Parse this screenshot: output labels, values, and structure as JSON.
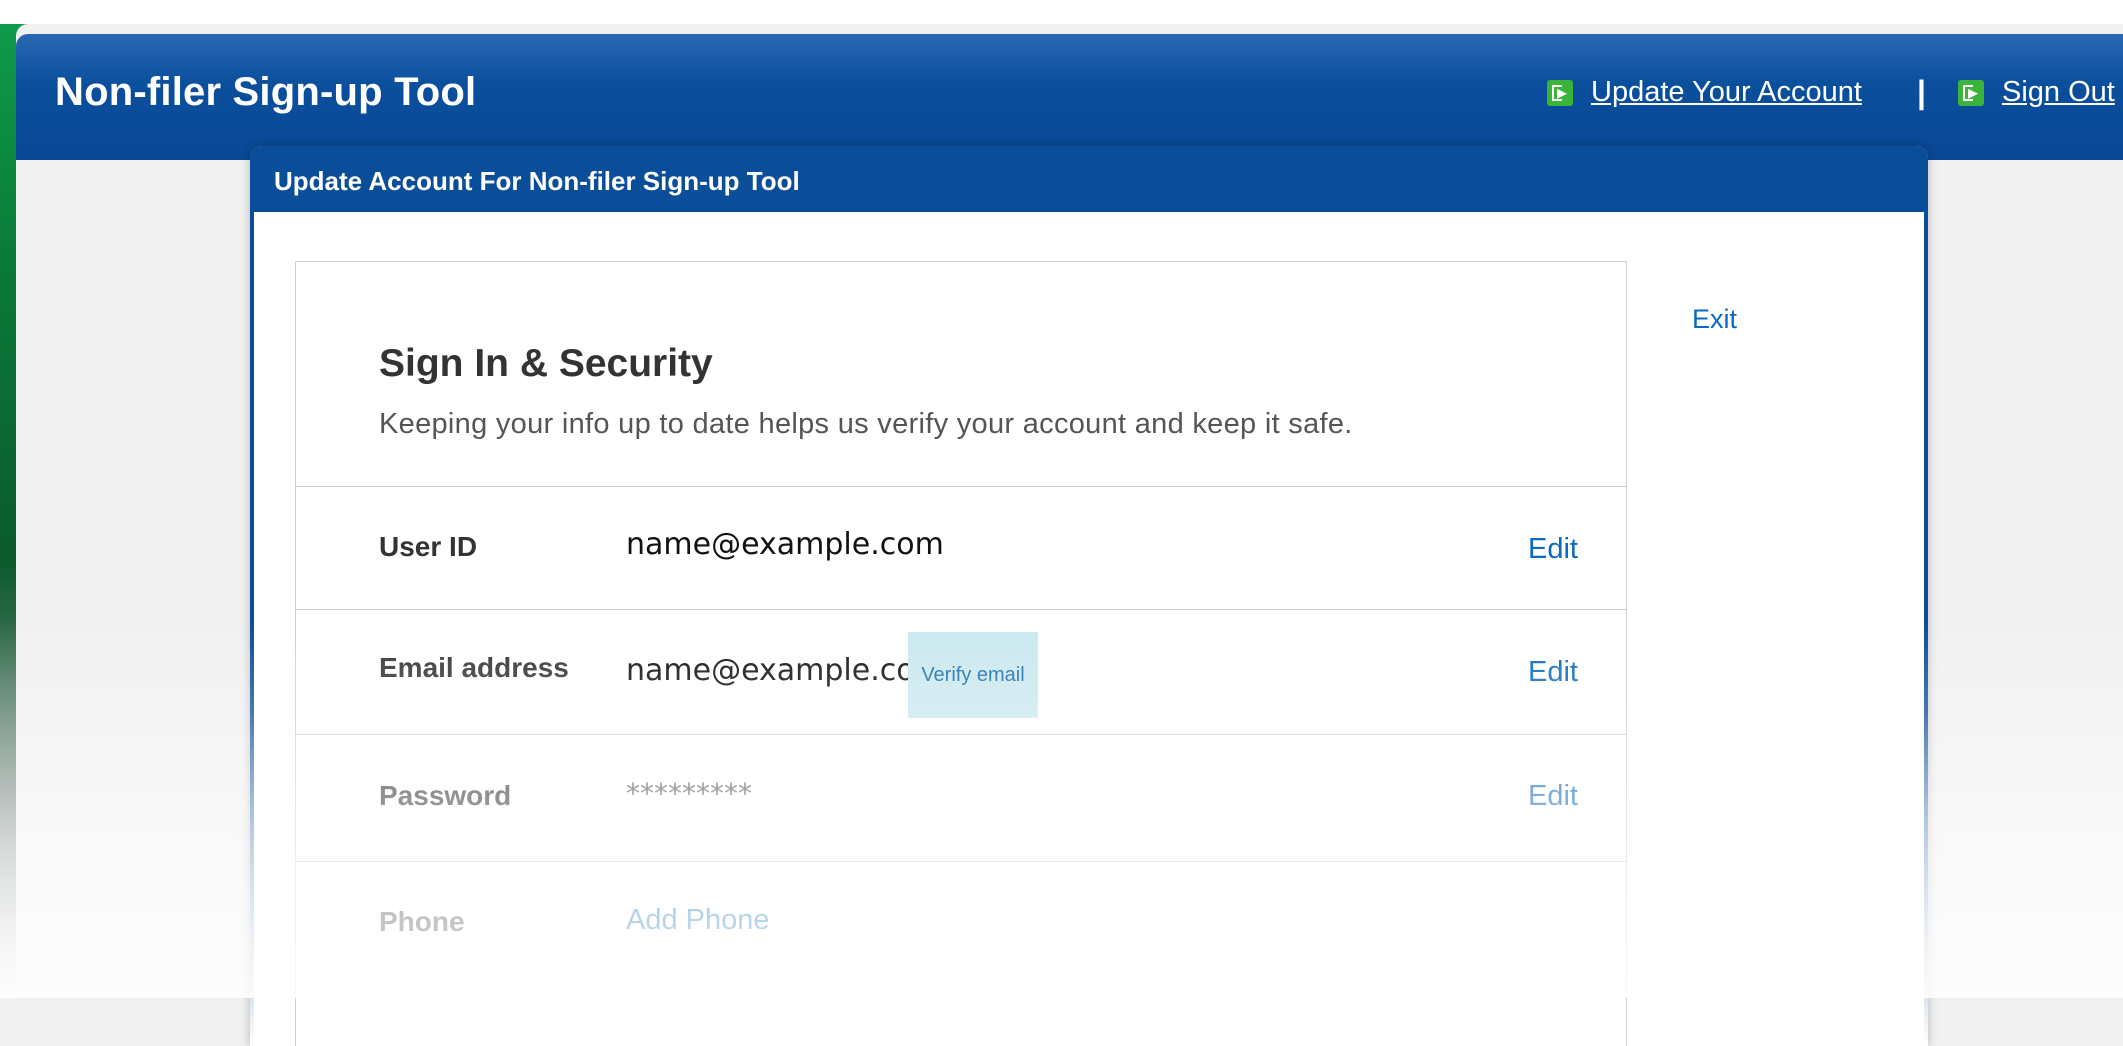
{
  "header": {
    "app_title": "Non-filer Sign-up Tool",
    "update_account_link": "Update Your Account",
    "separator": "|",
    "sign_out_link": "Sign Out",
    "icon": "exit-icon"
  },
  "panel": {
    "title": "Update Account For Non-filer Sign-up Tool",
    "exit_link": "Exit"
  },
  "card": {
    "title": "Sign In & Security",
    "subtitle": "Keeping your info up to date helps us verify your account and keep it safe.",
    "rows": [
      {
        "label": "User ID",
        "value": "name@example.com",
        "action": "Edit"
      },
      {
        "label": "Email address",
        "value": "name@example.com",
        "action": "Edit",
        "badge": "Verify email"
      },
      {
        "label": "Password",
        "value": "*********",
        "action": "Edit"
      },
      {
        "label": "Phone",
        "value": "Add Phone"
      }
    ]
  },
  "colors": {
    "header_blue": "#0a4d98",
    "link_blue": "#0a69c0",
    "green_accent": "#0f9a4a",
    "badge_bg": "#c9e8ef"
  }
}
